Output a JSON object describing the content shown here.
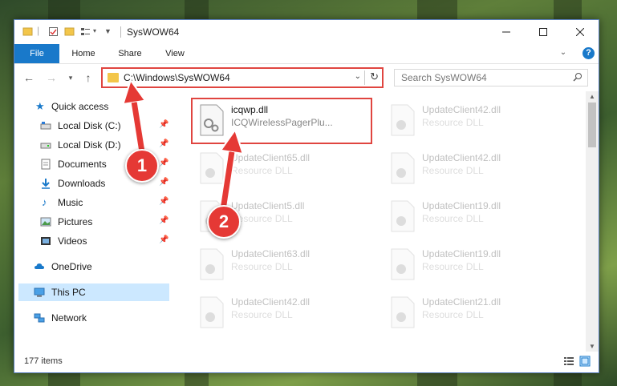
{
  "window": {
    "title": "SysWOW64",
    "controls": [
      "minimize",
      "maximize",
      "close"
    ]
  },
  "ribbon": {
    "tabs": [
      "File",
      "Home",
      "Share",
      "View"
    ],
    "help_label": "?"
  },
  "navbar": {
    "address": "C:\\Windows\\SysWOW64",
    "search_placeholder": "Search SysWOW64"
  },
  "sidebar": {
    "items": [
      {
        "label": "Quick access",
        "icon": "star-icon",
        "pinned": false
      },
      {
        "label": "Local Disk (C:)",
        "icon": "drive-icon",
        "pinned": true
      },
      {
        "label": "Local Disk (D:)",
        "icon": "drive-icon",
        "pinned": true
      },
      {
        "label": "Documents",
        "icon": "documents-icon",
        "pinned": true
      },
      {
        "label": "Downloads",
        "icon": "download-icon",
        "pinned": true
      },
      {
        "label": "Music",
        "icon": "music-icon",
        "pinned": true
      },
      {
        "label": "Pictures",
        "icon": "pictures-icon",
        "pinned": true
      },
      {
        "label": "Videos",
        "icon": "videos-icon",
        "pinned": true
      },
      {
        "label": "OneDrive",
        "icon": "cloud-icon",
        "pinned": false
      },
      {
        "label": "This PC",
        "icon": "computer-icon",
        "pinned": false,
        "selected": true
      },
      {
        "label": "Network",
        "icon": "network-icon",
        "pinned": false
      }
    ]
  },
  "files": {
    "highlighted": {
      "name": "icqwp.dll",
      "type": "ICQWirelessPagerPlu..."
    },
    "column1": [
      {
        "name": "UpdateClient65.dll",
        "type": "Resource DLL"
      },
      {
        "name": "UpdateClient5.dll",
        "type": "Resource DLL"
      },
      {
        "name": "UpdateClient63.dll",
        "type": "Resource DLL"
      },
      {
        "name": "UpdateClient42.dll",
        "type": "Resource DLL"
      }
    ],
    "column2": [
      {
        "name": "UpdateClient42.dll",
        "type": "Resource DLL"
      },
      {
        "name": "UpdateClient42.dll",
        "type": "Resource DLL"
      },
      {
        "name": "UpdateClient19.dll",
        "type": "Resource DLL"
      },
      {
        "name": "UpdateClient19.dll",
        "type": "Resource DLL"
      },
      {
        "name": "UpdateClient21.dll",
        "type": "Resource DLL"
      }
    ]
  },
  "status": {
    "item_count": "177 items"
  },
  "annotations": {
    "step1": "1",
    "step2": "2"
  },
  "colors": {
    "accent": "#1979ca",
    "highlight_border": "#e04540",
    "badge": "#e53935",
    "selection": "#cce8ff"
  }
}
